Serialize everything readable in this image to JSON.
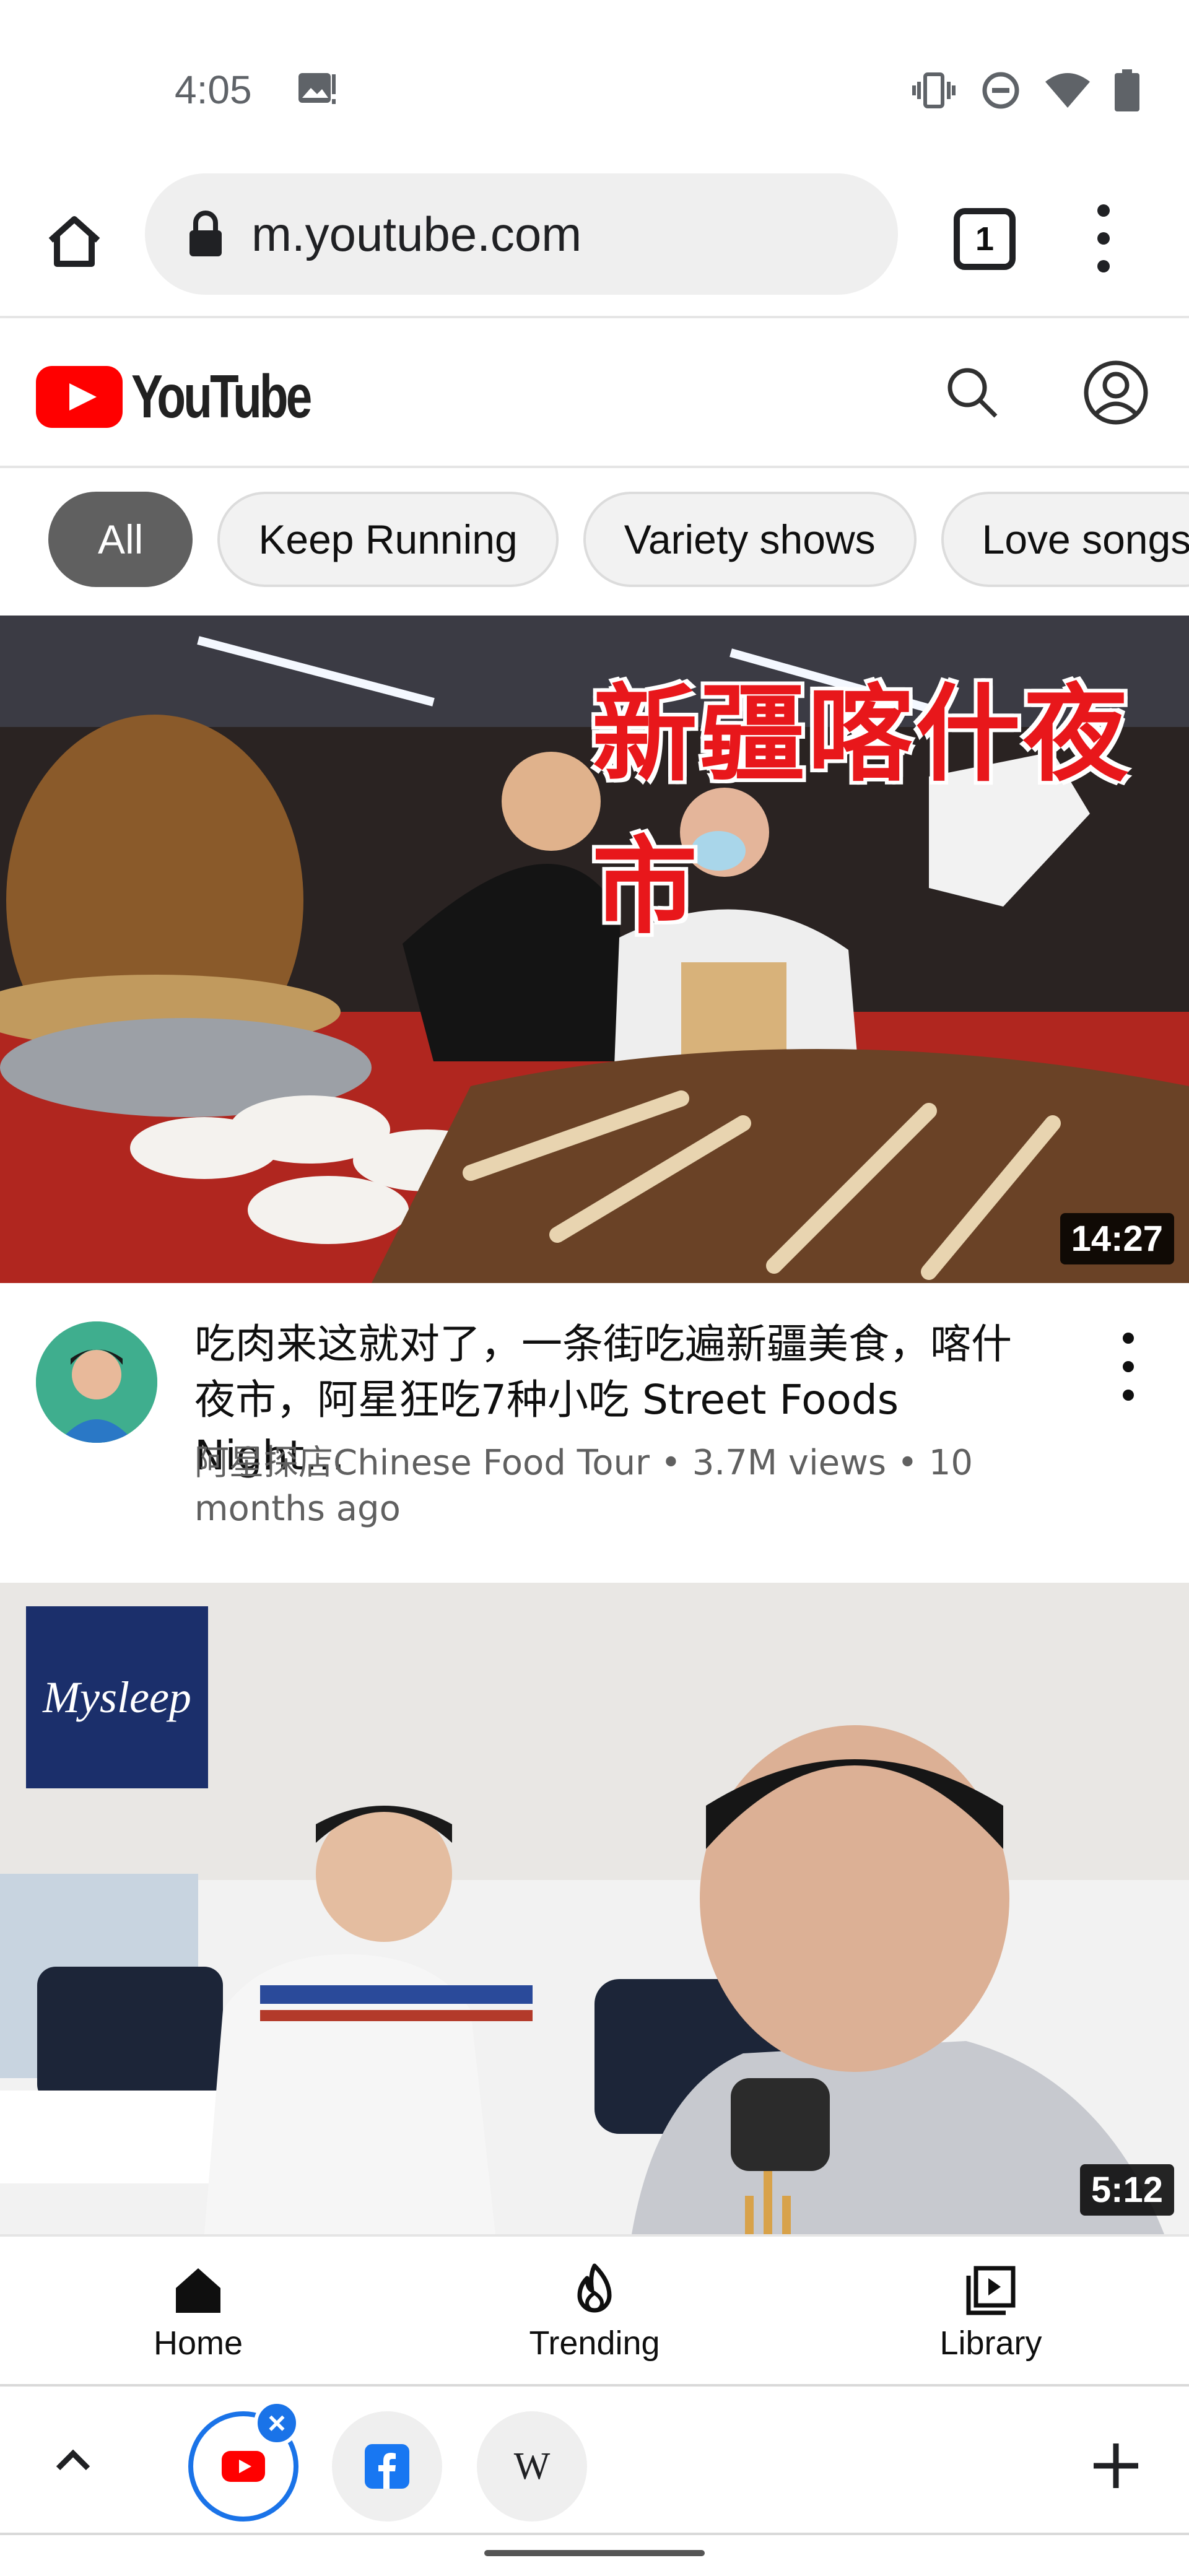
{
  "status_bar": {
    "time": "4:05"
  },
  "browser": {
    "url": "m.youtube.com",
    "tab_count": "1"
  },
  "youtube": {
    "logo_text": "YouTube",
    "brand_color": "#ff0000",
    "chips": [
      "All",
      "Keep Running",
      "Variety shows",
      "Love songs"
    ]
  },
  "videos": [
    {
      "thumbnail_overlay_text": "新疆喀什夜市",
      "duration": "14:27",
      "title": "吃肉来这就对了，一条街吃遍新疆美食，喀什夜市，阿星狂吃7种小吃 Street Foods Night…",
      "channel": "阿星探店Chinese Food Tour",
      "views": "3.7M views",
      "age": "10 months ago"
    },
    {
      "thumbnail_overlay_text": "Mysleep",
      "duration": "5:12"
    }
  ],
  "bottom_nav": [
    {
      "label": "Home",
      "icon": "home-icon"
    },
    {
      "label": "Trending",
      "icon": "flame-icon"
    },
    {
      "label": "Library",
      "icon": "library-icon"
    }
  ],
  "tab_strip": {
    "wiki_glyph": "W",
    "close_glyph": "×"
  }
}
